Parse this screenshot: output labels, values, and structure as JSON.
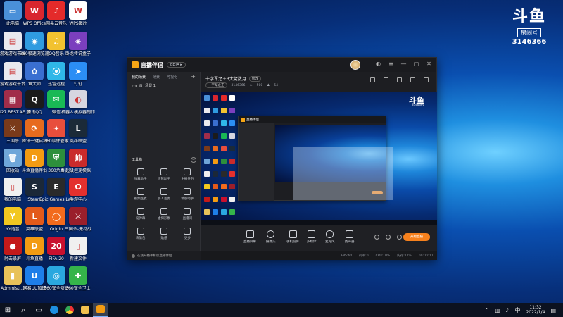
{
  "desktop": {
    "icons": [
      {
        "label": "此电脑",
        "glyph": "▭",
        "color": "#4a90d9"
      },
      {
        "label": "WPS Office",
        "glyph": "W",
        "color": "#d8262e"
      },
      {
        "label": "网易云音乐",
        "glyph": "♪",
        "color": "#e42a2a"
      },
      {
        "label": "WPS图片",
        "glyph": "W",
        "color": "#ffffff"
      },
      {
        "label": "游戏游戏平台",
        "glyph": "▤",
        "color": "#e9e9ef"
      },
      {
        "label": "360极速浏览器",
        "glyph": "◉",
        "color": "#2f9be0"
      },
      {
        "label": "QQ音乐",
        "glyph": "♫",
        "color": "#f2c230"
      },
      {
        "label": "卧龙传说盒子",
        "glyph": "◈",
        "color": "#7b3fbe"
      },
      {
        "label": "游戏游戏平台",
        "glyph": "▤",
        "color": "#e9e9ef"
      },
      {
        "label": "鱼大师",
        "glyph": "✿",
        "color": "#3a6fd1"
      },
      {
        "label": "迅雷远程",
        "glyph": "⦿",
        "color": "#2fb7e8"
      },
      {
        "label": "钉钉",
        "glyph": "➤",
        "color": "#2b8ef5"
      },
      {
        "label": "6027 BEST.AE 整...",
        "glyph": "▦",
        "color": "#a12d4a"
      },
      {
        "label": "腾讯QQ",
        "glyph": "Q",
        "color": "#1b1b1b"
      },
      {
        "label": "微信",
        "glyph": "✉",
        "color": "#19b955"
      },
      {
        "label": "机器人模拟器制作",
        "glyph": "◐",
        "color": "#d6d6e0"
      },
      {
        "label": "三国杀",
        "glyph": "⚔",
        "color": "#7a3a1a"
      },
      {
        "label": "腾讯一键启动",
        "glyph": "⟳",
        "color": "#e76b1e"
      },
      {
        "label": "360软件管家",
        "glyph": "✦",
        "color": "#e84e3c"
      },
      {
        "label": "英雄联盟",
        "glyph": "L",
        "color": "#1b2a38"
      },
      {
        "label": "回收站",
        "glyph": "🗑",
        "color": "#6fa6d9"
      },
      {
        "label": "斗鱼直播伴侣",
        "glyph": "D",
        "color": "#f39b12"
      },
      {
        "label": "360杀毒",
        "glyph": "⛨",
        "color": "#2d8f3c"
      },
      {
        "label": "超级坦克模拟",
        "glyph": "帅",
        "color": "#c92b2b"
      },
      {
        "label": "我的电脑",
        "glyph": "▯",
        "color": "#f0f0f0"
      },
      {
        "label": "Steam",
        "glyph": "S",
        "color": "#1b2838"
      },
      {
        "label": "Epic Games Launcher",
        "glyph": "E",
        "color": "#2a2a2a"
      },
      {
        "label": "手游中心",
        "glyph": "O",
        "color": "#e3302e"
      },
      {
        "label": "YY语音",
        "glyph": "Y",
        "color": "#f2c820"
      },
      {
        "label": "英雄联盟",
        "glyph": "L",
        "color": "#e35a1a"
      },
      {
        "label": "Origin",
        "glyph": "◯",
        "color": "#f26b1d"
      },
      {
        "label": "三国杀-无尽战",
        "glyph": "⚔",
        "color": "#9a1f2b"
      },
      {
        "label": "射击录屏",
        "glyph": "●",
        "color": "#c31a1a"
      },
      {
        "label": "斗鱼直播",
        "glyph": "D",
        "color": "#f39b12"
      },
      {
        "label": "FIFA 20",
        "glyph": "20",
        "color": "#c8102e"
      },
      {
        "label": "新建文件",
        "glyph": "▯",
        "color": "#f0f0f0"
      },
      {
        "label": "Administr...",
        "glyph": "▮",
        "color": "#e8c25a"
      },
      {
        "label": "网易UU加速",
        "glyph": "U",
        "color": "#1e7ee8"
      },
      {
        "label": "360安全防护",
        "glyph": "◎",
        "color": "#2aa8df"
      },
      {
        "label": "360安全卫士",
        "glyph": "✚",
        "color": "#35b44a"
      }
    ]
  },
  "watermark": {
    "logo": "斗鱼",
    "sub": "房间号",
    "room": "3146366"
  },
  "app": {
    "name": "直播伴侣",
    "beta": "BETA ▸",
    "tabs": [
      "我的场景",
      "场景",
      "可视化"
    ],
    "scene_label": "场景 1",
    "room_title": "十字军之王3大佬数月",
    "modify": "修改",
    "category": "十字军之王",
    "room_id": "3146366",
    "hot": "500",
    "followers": "54",
    "toolbox_title": "工具箱",
    "tools": [
      "弹幕助手",
      "房管助手",
      "主播任务",
      "视频连麦",
      "多人连麦",
      "情感助手",
      "设弹幕",
      "虚拟形象",
      "直播间",
      "表情包",
      "贴纸",
      "更多"
    ],
    "left_footer": "在线开播手机版直播伴侣",
    "controls": [
      "直播屏幕",
      "摄像头",
      "手机投屏",
      "多媒体",
      "麦克风",
      "扬声器"
    ],
    "start_button": "开始直播",
    "status": [
      "FPS:60",
      "码率:0",
      "CPU:10%",
      "内存:12%",
      "00:00:00"
    ]
  },
  "taskbar": {
    "clock_time": "11:32",
    "clock_date": "2022/1/4",
    "ime": "中"
  }
}
